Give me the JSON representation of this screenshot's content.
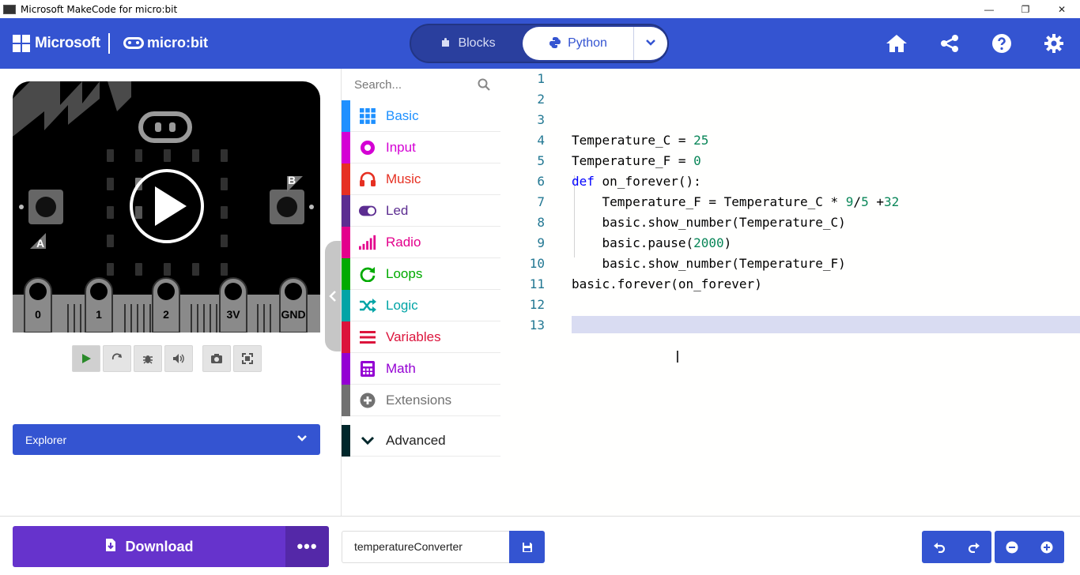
{
  "window": {
    "title": "Microsoft MakeCode for micro:bit",
    "minimize": "—",
    "restore": "❐",
    "close": "✕"
  },
  "header": {
    "brand": "Microsoft",
    "product": "micro:bit",
    "modes": {
      "blocks": "Blocks",
      "python": "Python"
    },
    "icons": [
      "home-icon",
      "share-icon",
      "help-icon",
      "settings-icon"
    ]
  },
  "simulator": {
    "buttons": {
      "a": "A",
      "b": "B"
    },
    "pins": [
      "0",
      "1",
      "2",
      "3V",
      "GND"
    ],
    "controls": [
      "play-icon",
      "restart-icon",
      "debug-icon",
      "sound-icon",
      "screenshot-icon",
      "fullscreen-icon"
    ],
    "explorer_label": "Explorer"
  },
  "toolbox": {
    "search_placeholder": "Search...",
    "categories": [
      {
        "label": "Basic",
        "color": "#1e90ff",
        "icon": "grid-icon"
      },
      {
        "label": "Input",
        "color": "#d400d4",
        "icon": "radio-dot-icon"
      },
      {
        "label": "Music",
        "color": "#e63022",
        "icon": "headphones-icon"
      },
      {
        "label": "Led",
        "color": "#5c2d91",
        "icon": "toggle-icon"
      },
      {
        "label": "Radio",
        "color": "#e3008c",
        "icon": "signal-bars-icon"
      },
      {
        "label": "Loops",
        "color": "#00aa00",
        "icon": "refresh-icon"
      },
      {
        "label": "Logic",
        "color": "#00a4a6",
        "icon": "shuffle-icon"
      },
      {
        "label": "Variables",
        "color": "#dc143c",
        "icon": "list-lines-icon"
      },
      {
        "label": "Math",
        "color": "#9400d3",
        "icon": "calculator-icon"
      },
      {
        "label": "Extensions",
        "color": "#717171",
        "icon": "plus-circle-icon"
      },
      {
        "label": "Advanced",
        "color": "#00272b",
        "icon": "chevron-down-icon"
      }
    ]
  },
  "editor": {
    "line_numbers": [
      "1",
      "2",
      "3",
      "4",
      "5",
      "6",
      "7",
      "8",
      "9",
      "10",
      "11",
      "12",
      "13"
    ],
    "lines": [
      {
        "parts": []
      },
      {
        "parts": []
      },
      {
        "parts": []
      },
      {
        "parts": [
          [
            "t",
            "Temperature_C = "
          ],
          [
            "n",
            "25"
          ]
        ]
      },
      {
        "parts": [
          [
            "t",
            "Temperature_F = "
          ],
          [
            "n",
            "0"
          ]
        ]
      },
      {
        "parts": [
          [
            "k",
            "def"
          ],
          [
            "t",
            " on_forever():"
          ]
        ]
      },
      {
        "parts": [
          [
            "t",
            "    Temperature_F = Temperature_C * "
          ],
          [
            "n",
            "9"
          ],
          [
            "t",
            "/"
          ],
          [
            "n",
            "5"
          ],
          [
            "t",
            " +"
          ],
          [
            "n",
            "32"
          ]
        ]
      },
      {
        "parts": [
          [
            "t",
            "    basic.show_number(Temperature_C)"
          ]
        ]
      },
      {
        "parts": [
          [
            "t",
            "    basic.pause("
          ],
          [
            "n",
            "2000"
          ],
          [
            "t",
            ")"
          ]
        ]
      },
      {
        "parts": [
          [
            "t",
            "    basic.show_number(Temperature_F)"
          ]
        ]
      },
      {
        "parts": [
          [
            "t",
            "basic.forever(on_forever)"
          ]
        ]
      },
      {
        "parts": []
      },
      {
        "parts": []
      }
    ]
  },
  "footer": {
    "download_label": "Download",
    "more_label": "•••",
    "project_name": "temperatureConverter",
    "controls": [
      "undo-icon",
      "redo-icon",
      "zoom-out-icon",
      "zoom-in-icon"
    ]
  }
}
